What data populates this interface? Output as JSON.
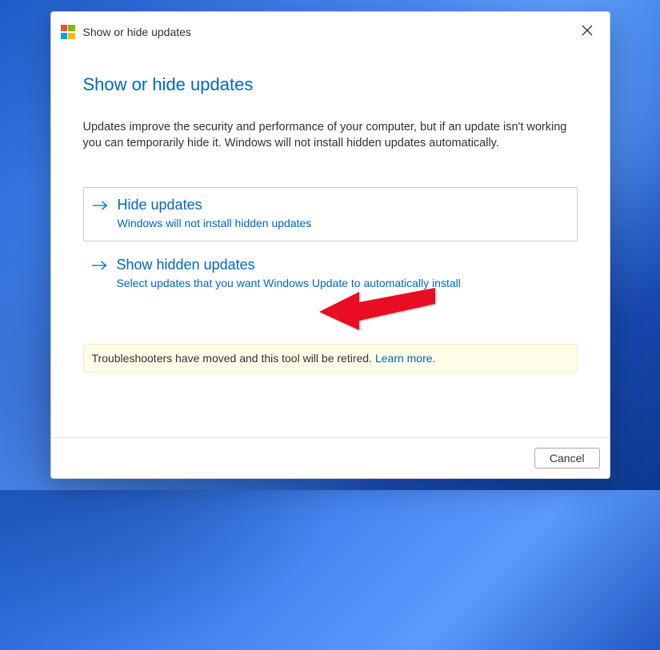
{
  "window": {
    "title": "Show or hide updates"
  },
  "header": {
    "heading": "Show or hide updates",
    "description": "Updates improve the security and performance of your computer, but if an update isn't working you can temporarily hide it. Windows will not install hidden updates automatically."
  },
  "options": [
    {
      "title": "Hide updates",
      "subtitle": "Windows will not install hidden updates"
    },
    {
      "title": "Show hidden updates",
      "subtitle": "Select updates that you want Windows Update to automatically install"
    }
  ],
  "notice": {
    "text": "Troubleshooters have moved and this tool will be retired.",
    "link_text": "Learn more."
  },
  "footer": {
    "cancel_label": "Cancel"
  },
  "icons": {
    "close": "close-icon",
    "arrow_right": "arrow-right-icon",
    "ms_logo": "microsoft-logo"
  },
  "colors": {
    "accent": "#0066cc",
    "notice_bg": "#fffde7"
  }
}
